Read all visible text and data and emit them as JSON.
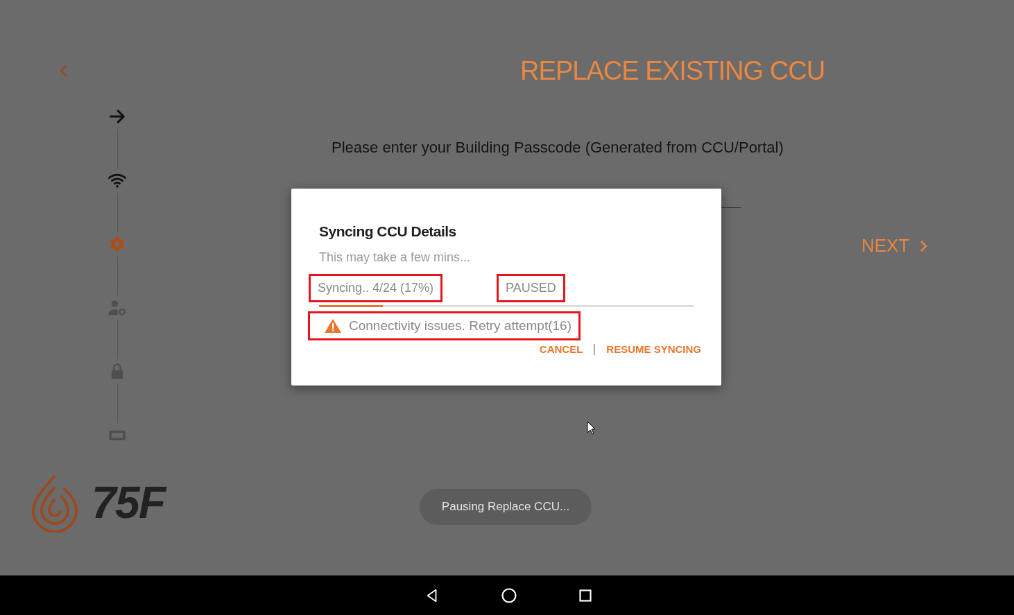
{
  "header": {
    "title": "REPLACE EXISTING CCU"
  },
  "steps": [
    {
      "kind": "arrow",
      "completed": true,
      "selected": false
    },
    {
      "kind": "wifi",
      "completed": true,
      "selected": false
    },
    {
      "kind": "gear",
      "completed": false,
      "selected": true
    },
    {
      "kind": "user-settings",
      "completed": false,
      "selected": false
    },
    {
      "kind": "lock",
      "completed": false,
      "selected": false
    },
    {
      "kind": "device",
      "completed": false,
      "selected": false
    }
  ],
  "prompt": "Please enter your Building Passcode (Generated from CCU/Portal)",
  "next_button": "NEXT",
  "logo_text": "75F",
  "dialog": {
    "title": "Syncing CCU Details",
    "subtitle": "This may take a few mins...",
    "progress_text": {
      "text": "Syncing.. 4/24 (17%)",
      "highlighted": true
    },
    "state_text": {
      "text": "PAUSED",
      "highlighted": true
    },
    "progress": {
      "level": 0.17
    },
    "warning": {
      "text": "Connectivity issues. Retry attempt(16)",
      "highlighted": true
    },
    "buttons": [
      "CANCEL",
      "RESUME SYNCING"
    ]
  },
  "toast": "Pausing Replace CCU...",
  "nav_bar": [
    {
      "kind": "back"
    },
    {
      "kind": "home"
    },
    {
      "kind": "recents"
    }
  ]
}
